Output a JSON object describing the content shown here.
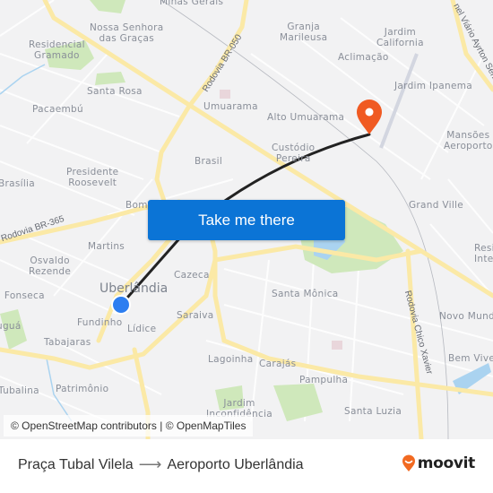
{
  "map": {
    "labels": [
      {
        "text": "Minas Gerais",
        "kind": "area"
      },
      {
        "text": "Nossa Senhora\ndas Graças",
        "kind": "area"
      },
      {
        "text": "Residencial\nGramado",
        "kind": "area"
      },
      {
        "text": "Santa Rosa",
        "kind": "area"
      },
      {
        "text": "Pacaembú",
        "kind": "area"
      },
      {
        "text": "Umuarama",
        "kind": "area"
      },
      {
        "text": "Granja\nMarileusa",
        "kind": "area"
      },
      {
        "text": "Jardim\nCalifornia",
        "kind": "area"
      },
      {
        "text": "Aclimação",
        "kind": "area"
      },
      {
        "text": "Jardim Ipanema",
        "kind": "area"
      },
      {
        "text": "Alto Umuarama",
        "kind": "area"
      },
      {
        "text": "Mansões\nAeroporto",
        "kind": "area"
      },
      {
        "text": "Custódio\nPereira",
        "kind": "area"
      },
      {
        "text": "Brasil",
        "kind": "area"
      },
      {
        "text": "Presidente\nRoosevelt",
        "kind": "area"
      },
      {
        "text": "Brasília",
        "kind": "area"
      },
      {
        "text": "Bom",
        "kind": "area"
      },
      {
        "text": "Grand Ville",
        "kind": "area"
      },
      {
        "text": "Resi\nInte",
        "kind": "area"
      },
      {
        "text": "Martins",
        "kind": "area"
      },
      {
        "text": "Osvaldo\nRezende",
        "kind": "area"
      },
      {
        "text": "Cazeca",
        "kind": "area"
      },
      {
        "text": "Uberlândia",
        "kind": "city"
      },
      {
        "text": "l Fonseca",
        "kind": "area"
      },
      {
        "text": "Santa Mônica",
        "kind": "area"
      },
      {
        "text": "Novo Mund",
        "kind": "area"
      },
      {
        "text": "Fundinho",
        "kind": "area"
      },
      {
        "text": "Lídice",
        "kind": "area"
      },
      {
        "text": "Saraiva",
        "kind": "area"
      },
      {
        "text": "uguá",
        "kind": "area"
      },
      {
        "text": "Tabajaras",
        "kind": "area"
      },
      {
        "text": "Bem Vive",
        "kind": "area"
      },
      {
        "text": "Lagoinha",
        "kind": "area"
      },
      {
        "text": "Carajás",
        "kind": "area"
      },
      {
        "text": "Pampulha",
        "kind": "area"
      },
      {
        "text": "Tubalina",
        "kind": "area"
      },
      {
        "text": "Patrimônio",
        "kind": "area"
      },
      {
        "text": "Jardim\nInconfidência",
        "kind": "area"
      },
      {
        "text": "Santa Luzia",
        "kind": "area"
      }
    ],
    "roads": [
      {
        "text": "Rodovia BR-050"
      },
      {
        "text": "Rodovia BR-365"
      },
      {
        "text": "Rodovia Chico Xavier"
      },
      {
        "text": "nel Viário Ayrton Senna"
      }
    ],
    "origin_marker": {
      "name": "Praça Tubal Vilela",
      "color": "#2d7ef0"
    },
    "destination_marker": {
      "name": "Aeroporto Uberlândia",
      "color": "#f05a22"
    },
    "route_color": "#222222",
    "colors": {
      "road_major": "#fbe9a6",
      "park": "#cfe8bb",
      "water": "#aad3f0",
      "background": "#f2f2f3"
    }
  },
  "cta": {
    "label": "Take me there",
    "color": "#0b74d6"
  },
  "attribution": "© OpenStreetMap contributors | © OpenMapTiles",
  "footer": {
    "origin": "Praça Tubal Vilela",
    "arrow": "⟶",
    "destination": "Aeroporto Uberlândia",
    "brand": "moovit",
    "brand_color": "#f26a21"
  }
}
